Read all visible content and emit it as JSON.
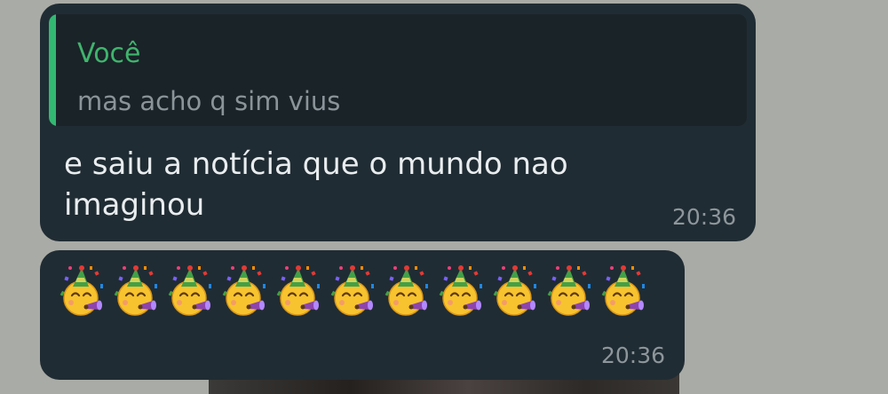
{
  "chat": {
    "messages": [
      {
        "reply_to": {
          "author": "Você",
          "text": "mas acho q sim vius"
        },
        "text": "e saiu a notícia que o mundo nao imaginou",
        "time": "20:36"
      },
      {
        "emoji": "partying-face-emoji",
        "emoji_count": 11,
        "time": "20:36"
      }
    ]
  },
  "colors": {
    "background": "#a9aba6",
    "bubble": "#202c33",
    "quote_bar": "#33b872",
    "quote_author": "#40b46d",
    "text": "#e9edef",
    "meta": "#8d969b"
  }
}
